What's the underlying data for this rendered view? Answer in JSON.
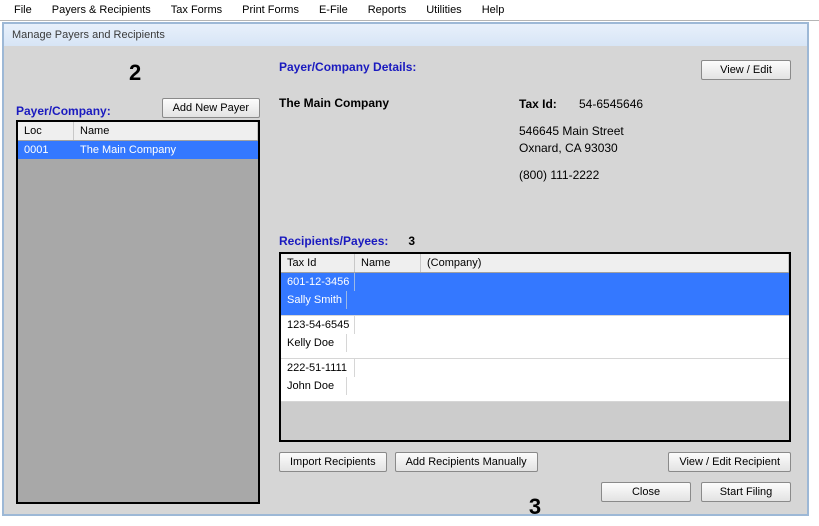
{
  "menu": [
    "File",
    "Payers & Recipients",
    "Tax Forms",
    "Print Forms",
    "E-File",
    "Reports",
    "Utilities",
    "Help"
  ],
  "window_title": "Manage Payers and Recipients",
  "payer_section_label": "Payer/Company:",
  "add_payer_btn": "Add New Payer",
  "annotation2": "2",
  "payers_table": {
    "headers": [
      "Loc",
      "Name"
    ],
    "rows": [
      {
        "loc": "0001",
        "name": "The Main Company",
        "selected": true
      }
    ]
  },
  "details": {
    "heading": "Payer/Company Details:",
    "view_edit_btn": "View / Edit",
    "company_name": "The Main Company",
    "taxid_label": "Tax Id:",
    "taxid": "54-6545646",
    "addr1": "546645 Main Street",
    "addr2": "Oxnard, CA  93030",
    "phone": "(800) 111-2222"
  },
  "recipients": {
    "heading": "Recipients/Payees:",
    "count": "3",
    "headers": [
      "Tax Id",
      "Name",
      "(Company)"
    ],
    "rows": [
      {
        "taxid": "601-12-3456",
        "name": "Sally  Smith",
        "company": "",
        "selected": true
      },
      {
        "taxid": "123-54-6545",
        "name": "Kelly  Doe",
        "company": "",
        "selected": false
      },
      {
        "taxid": "222-51-1111",
        "name": "John  Doe",
        "company": "",
        "selected": false
      }
    ],
    "annotation3": "3",
    "import_btn": "Import Recipients",
    "add_manual_btn": "Add Recipients Manually",
    "view_edit_recip_btn": "View / Edit Recipient"
  },
  "footer": {
    "close_btn": "Close",
    "start_filing_btn": "Start Filing"
  }
}
